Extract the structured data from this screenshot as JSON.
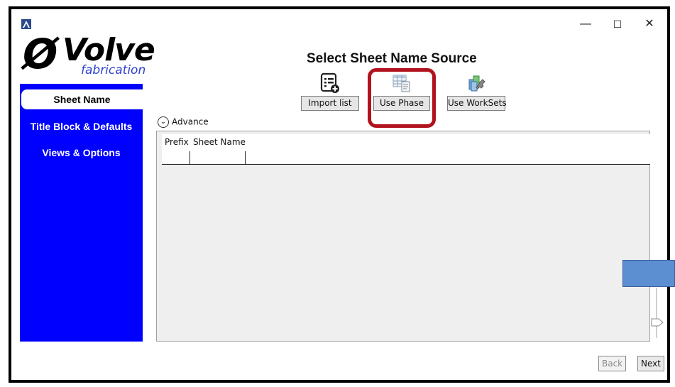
{
  "window": {
    "minimize_glyph": "—",
    "maximize_glyph": "☐",
    "close_glyph": "✕"
  },
  "logo": {
    "mark": "Ø",
    "word": "Volve",
    "sub": "fabrication"
  },
  "sidebar": {
    "items": [
      {
        "label": "Sheet Name",
        "active": true
      },
      {
        "label": "Title Block & Defaults",
        "active": false
      },
      {
        "label": "Views & Options",
        "active": false
      }
    ],
    "color": "#0000ff"
  },
  "main": {
    "title": "Select Sheet Name Source",
    "tools": [
      {
        "label": "Import list",
        "icon": "list-add-icon"
      },
      {
        "label": "Use Phase",
        "icon": "table-doc-icon"
      },
      {
        "label": "Use WorkSets",
        "icon": "cubes-wrench-icon"
      }
    ],
    "highlight_color": "#b1121d",
    "advance_label": "Advance",
    "grid": {
      "columns": [
        "Prefix",
        "Sheet Name"
      ],
      "rows": [
        [
          "",
          ""
        ]
      ]
    }
  },
  "footer": {
    "back_label": "Back",
    "next_label": "Next"
  }
}
